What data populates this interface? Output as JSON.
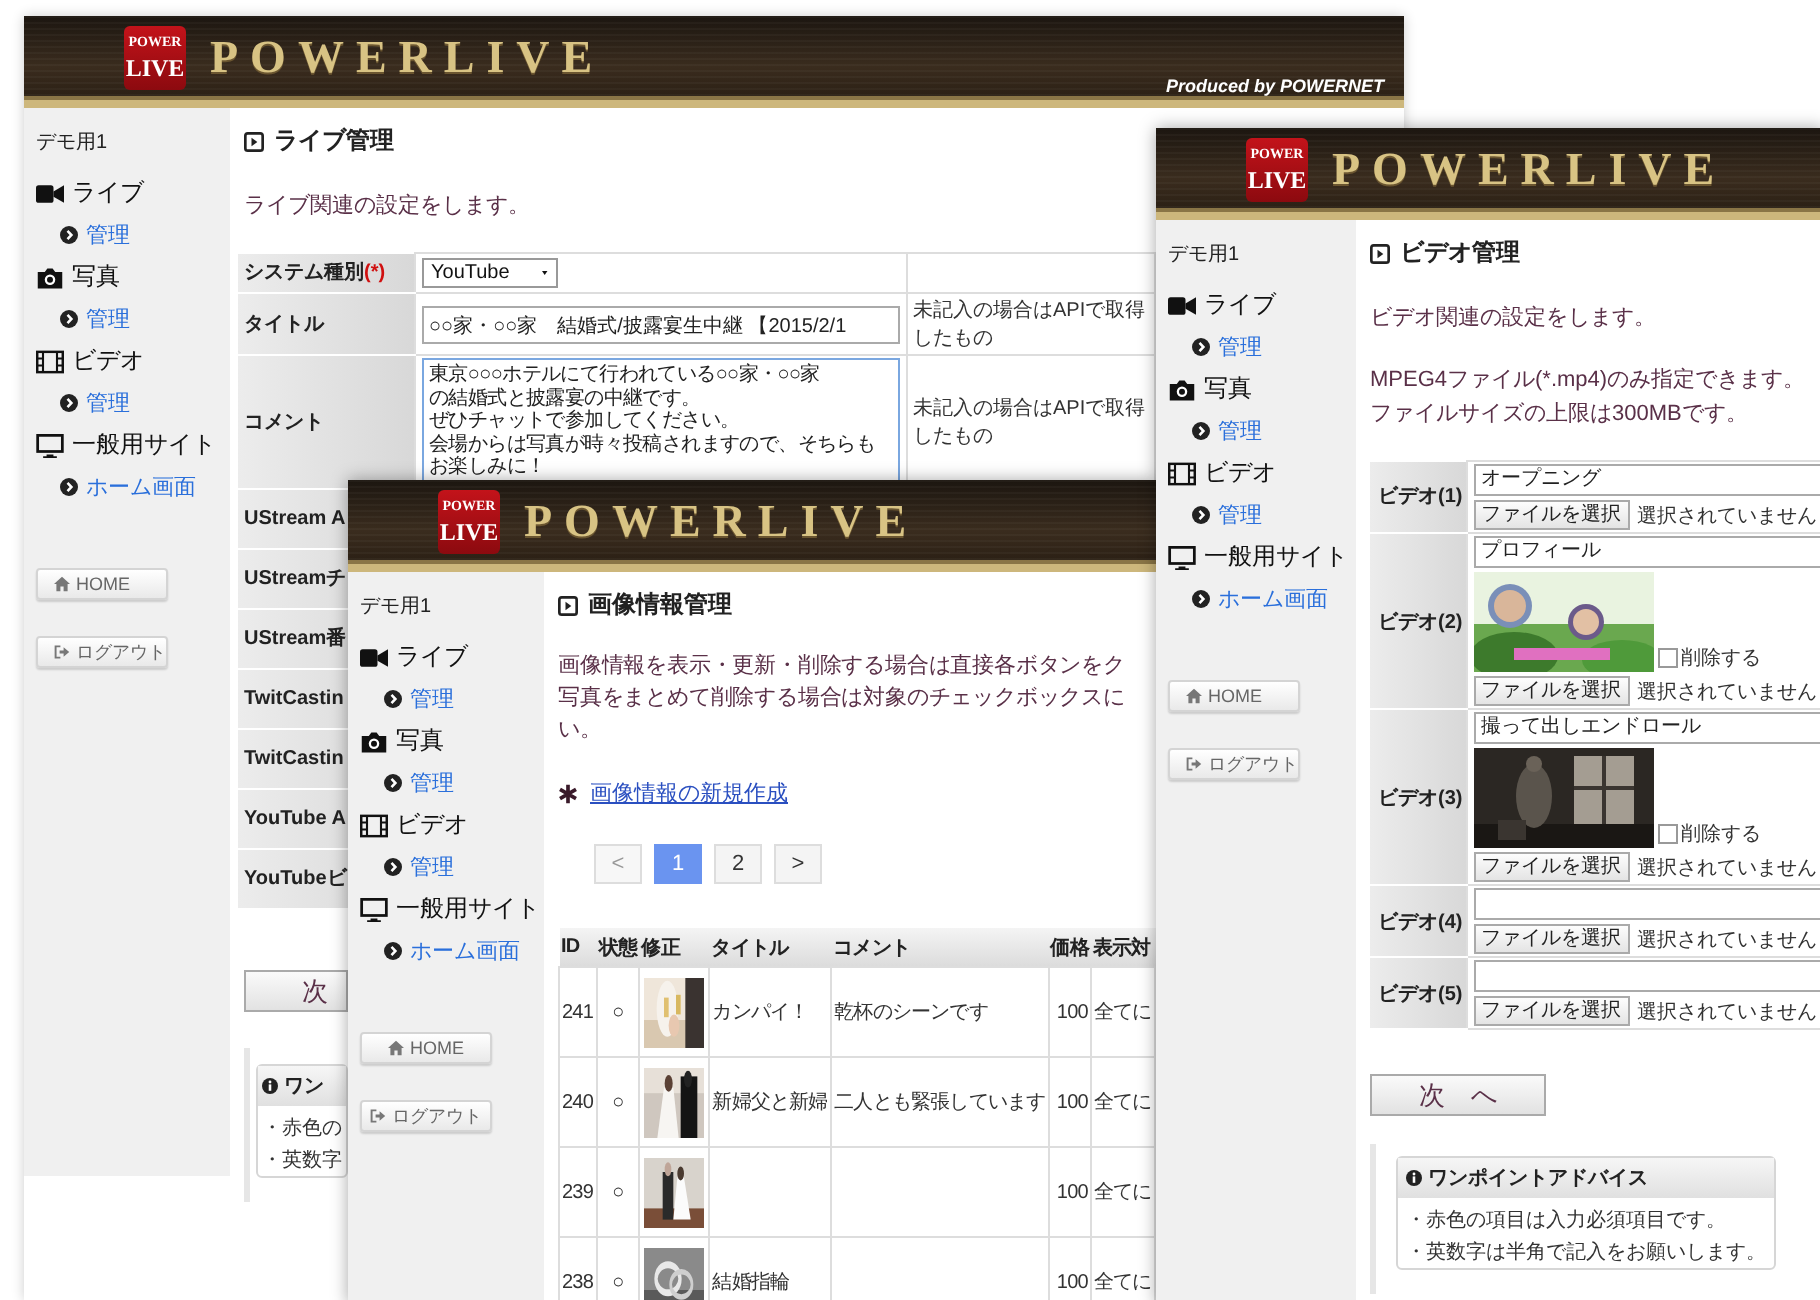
{
  "windows": [
    {
      "header": {
        "logo_top": "POWER",
        "logo_bottom": "LIVE",
        "brand": "POWERLIVE",
        "produced_by": "Produced by POWERNET"
      },
      "sidebar": {
        "user": "デモ用1",
        "sections": [
          {
            "label": "ライブ",
            "kind": "video",
            "children": [
              {
                "label": "管理"
              }
            ]
          },
          {
            "label": "写真",
            "kind": "camera",
            "children": [
              {
                "label": "管理"
              }
            ]
          },
          {
            "label": "ビデオ",
            "kind": "film",
            "children": [
              {
                "label": "管理"
              }
            ]
          },
          {
            "label": "一般用サイト",
            "kind": "monitor",
            "children": [
              {
                "label": "ホーム画面"
              }
            ]
          }
        ],
        "buttons": [
          {
            "label": "HOME",
            "kind": "home"
          },
          {
            "label": "ログアウト",
            "kind": "logout"
          }
        ]
      },
      "page": {
        "heading": "ライブ管理",
        "description": "ライブ関連の設定をします。",
        "form_rows": [
          {
            "kind": "select",
            "label": "システム種別",
            "required_mark": "(*)",
            "value": "YouTube"
          },
          {
            "kind": "text",
            "label": "タイトル",
            "value": "○○家・○○家　結婚式/披露宴生中継 【2015/2/1",
            "note": "未記入の場合はAPIで取得したもの"
          },
          {
            "kind": "textarea",
            "label": "コメント",
            "lines": [
              "東京○○○ホテルにて行われている○○家・○○家",
              "の結婚式と披露宴の中継です。",
              "ぜひチャットで参加してください。",
              "会場からは写真が時々投稿されますので、そちらも",
              "お楽しみに！"
            ],
            "note": "未記入の場合はAPIで取得したもの"
          },
          {
            "kind": "label_only",
            "label": "UStream A"
          },
          {
            "kind": "label_only",
            "label": "UStreamチ"
          },
          {
            "kind": "label_only",
            "label": "UStream番"
          },
          {
            "kind": "label_only",
            "label": "TwitCastin"
          },
          {
            "kind": "label_only",
            "label": "TwitCastin"
          },
          {
            "kind": "label_only",
            "label": "YouTube A"
          },
          {
            "kind": "label_only",
            "label": "YouTubeビ"
          }
        ],
        "next_button": "次",
        "advice": {
          "title": "ワン",
          "lines": [
            "・赤色の",
            "・英数字"
          ]
        }
      }
    },
    {
      "header": {
        "logo_top": "POWER",
        "logo_bottom": "LIVE",
        "brand": "POWERLIVE"
      },
      "sidebar": {
        "user": "デモ用1",
        "sections": [
          {
            "label": "ライブ",
            "kind": "video",
            "children": [
              {
                "label": "管理"
              }
            ]
          },
          {
            "label": "写真",
            "kind": "camera",
            "children": [
              {
                "label": "管理"
              }
            ]
          },
          {
            "label": "ビデオ",
            "kind": "film",
            "children": [
              {
                "label": "管理"
              }
            ]
          },
          {
            "label": "一般用サイト",
            "kind": "monitor",
            "children": [
              {
                "label": "ホーム画面"
              }
            ]
          }
        ],
        "buttons": [
          {
            "label": "HOME",
            "kind": "home"
          },
          {
            "label": "ログアウト",
            "kind": "logout"
          }
        ]
      },
      "page": {
        "heading": "画像情報管理",
        "description_lines": [
          "画像情報を表示・更新・削除する場合は直接各ボタンをク",
          "写真をまとめて削除する場合は対象のチェックボックスに",
          "い。"
        ],
        "new_link": "画像情報の新規作成",
        "pagination": {
          "prev": {
            "label": "<",
            "disabled": true
          },
          "pages": [
            {
              "label": "1",
              "selected": true
            },
            {
              "label": "2",
              "selected": false
            }
          ],
          "next": {
            "label": ">",
            "disabled": false
          }
        },
        "table": {
          "columns": [
            "ID",
            "状態",
            "修正",
            "タイトル",
            "コメント",
            "価格",
            "表示対"
          ],
          "rows": [
            {
              "id": "241",
              "status": "○",
              "title": "カンパイ！",
              "comment": "乾杯のシーンです",
              "price": "100",
              "display": "全てに"
            },
            {
              "id": "240",
              "status": "○",
              "title": "新婦父と新婦",
              "comment": "二人とも緊張しています",
              "price": "100",
              "display": "全てに"
            },
            {
              "id": "239",
              "status": "○",
              "price": "100",
              "display": "全てに"
            },
            {
              "id": "238",
              "status": "○",
              "title": "結婚指輪",
              "price": "100",
              "display": "全てに"
            }
          ]
        }
      }
    },
    {
      "header": {
        "logo_top": "POWER",
        "logo_bottom": "LIVE",
        "brand": "POWERLIVE"
      },
      "sidebar": {
        "user": "デモ用1",
        "sections": [
          {
            "label": "ライブ",
            "kind": "video",
            "children": [
              {
                "label": "管理"
              }
            ]
          },
          {
            "label": "写真",
            "kind": "camera",
            "children": [
              {
                "label": "管理"
              }
            ]
          },
          {
            "label": "ビデオ",
            "kind": "film",
            "children": [
              {
                "label": "管理"
              }
            ]
          },
          {
            "label": "一般用サイト",
            "kind": "monitor",
            "children": [
              {
                "label": "ホーム画面"
              }
            ]
          }
        ],
        "buttons": [
          {
            "label": "HOME",
            "kind": "home"
          },
          {
            "label": "ログアウト",
            "kind": "logout"
          }
        ]
      },
      "page": {
        "heading": "ビデオ管理",
        "description": "ビデオ関連の設定をします。",
        "notes": [
          "MPEG4ファイル(*.mp4)のみ指定できます。",
          "ファイルサイズの上限は300MBです。"
        ],
        "videos": [
          {
            "label": "ビデオ(1)",
            "title": "オープニング",
            "file_button": "ファイルを選択",
            "file_status": "選択されていません"
          },
          {
            "label": "ビデオ(2)",
            "title": "プロフィール",
            "delete": {
              "label": "削除する",
              "checked": false
            },
            "file_button": "ファイルを選択",
            "file_status": "選択されていません"
          },
          {
            "label": "ビデオ(3)",
            "title": "撮って出しエンドロール",
            "delete": {
              "label": "削除する",
              "checked": false
            },
            "file_button": "ファイルを選択",
            "file_status": "選択されていません"
          },
          {
            "label": "ビデオ(4)",
            "file_button": "ファイルを選択",
            "file_status": "選択されていません"
          },
          {
            "label": "ビデオ(5)",
            "file_button": "ファイルを選択",
            "file_status": "選択されていません"
          }
        ],
        "next_button": "次　へ",
        "advice": {
          "title": "ワンポイントアドバイス",
          "lines": [
            "・赤色の項目は入力必須項目です。",
            "・英数字は半角で記入をお願いします。"
          ]
        }
      }
    }
  ]
}
